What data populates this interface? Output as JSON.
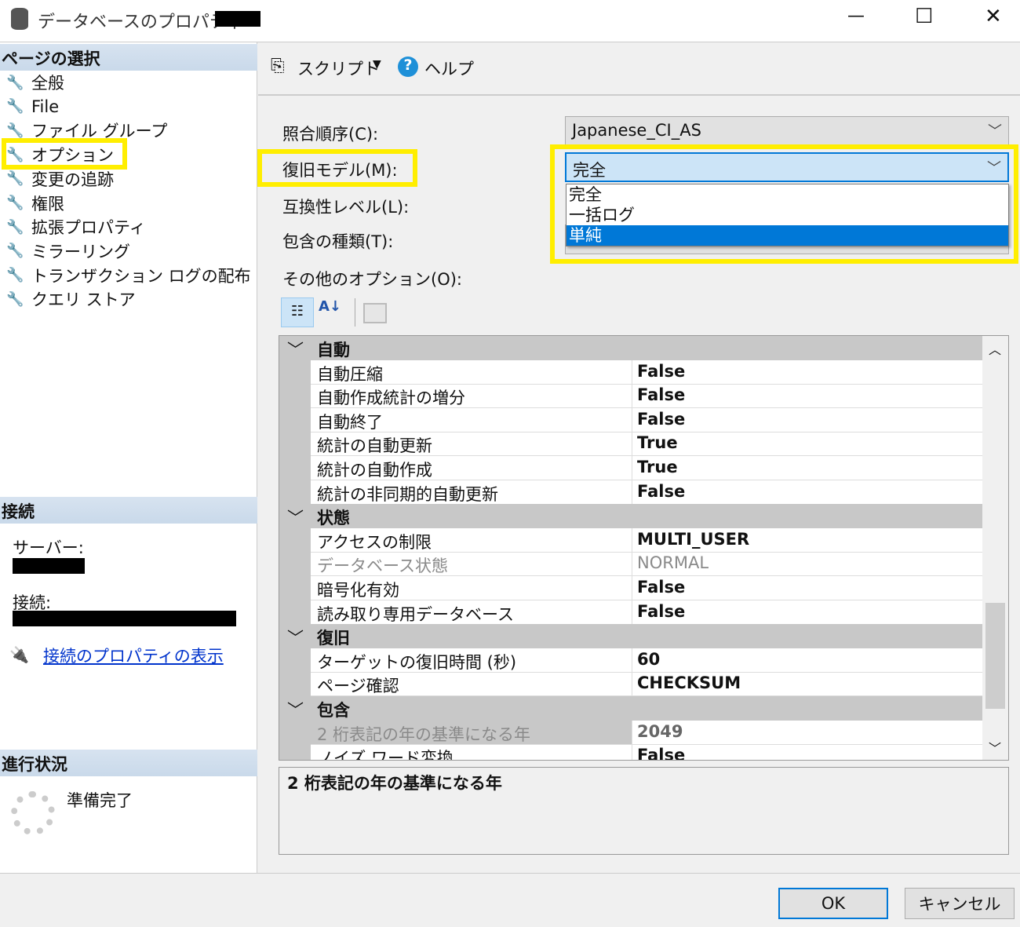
{
  "window": {
    "title": "データベースのプロパティ -",
    "minimize": "—",
    "maximize": "☐",
    "close": "✕"
  },
  "sidebar": {
    "select_page_header": "ページの選択",
    "items": [
      {
        "label": "全般"
      },
      {
        "label": "File"
      },
      {
        "label": "ファイル グループ"
      },
      {
        "label": "オプション"
      },
      {
        "label": "変更の追跡"
      },
      {
        "label": "権限"
      },
      {
        "label": "拡張プロパティ"
      },
      {
        "label": "ミラーリング"
      },
      {
        "label": "トランザクション ログの配布"
      },
      {
        "label": "クエリ ストア"
      }
    ],
    "connection_header": "接続",
    "server_label": "サーバー:",
    "connection_label": "接続:",
    "view_connection_link": "接続のプロパティの表示",
    "progress_header": "進行状況",
    "progress_status": "準備完了"
  },
  "toolbar": {
    "script": "スクリプト",
    "help": "ヘルプ"
  },
  "form": {
    "collation_label": "照合順序(C):",
    "collation_value": "Japanese_CI_AS",
    "recovery_label": "復旧モデル(M):",
    "recovery_value": "完全",
    "recovery_options": [
      "完全",
      "一括ログ",
      "単純"
    ],
    "compat_label": "互換性レベル(L):",
    "containment_label": "包含の種類(T):",
    "other_label": "その他のオプション(O):"
  },
  "grid": {
    "rows": [
      {
        "type": "cat",
        "name": "自動"
      },
      {
        "name": "自動圧縮",
        "value": "False"
      },
      {
        "name": "自動作成統計の増分",
        "value": "False"
      },
      {
        "name": "自動終了",
        "value": "False"
      },
      {
        "name": "統計の自動更新",
        "value": "True"
      },
      {
        "name": "統計の自動作成",
        "value": "True"
      },
      {
        "name": "統計の非同期的自動更新",
        "value": "False"
      },
      {
        "type": "cat",
        "name": "状態"
      },
      {
        "name": "アクセスの制限",
        "value": "MULTI_USER"
      },
      {
        "name": "データベース状態",
        "value": "NORMAL",
        "disabled": true
      },
      {
        "name": "暗号化有効",
        "value": "False"
      },
      {
        "name": "読み取り専用データベース",
        "value": "False"
      },
      {
        "type": "cat",
        "name": "復旧"
      },
      {
        "name": "ターゲットの復旧時間 (秒)",
        "value": "60"
      },
      {
        "name": "ページ確認",
        "value": "CHECKSUM"
      },
      {
        "type": "cat",
        "name": "包含"
      },
      {
        "name": "2 桁表記の年の基準になる年",
        "value": "2049",
        "selected": true
      },
      {
        "name": "ノイズ ワード変換",
        "value": "False"
      }
    ],
    "description": "2 桁表記の年の基準になる年"
  },
  "buttons": {
    "ok": "OK",
    "cancel": "キャンセル"
  },
  "colors": {
    "highlight": "#ffee00",
    "selection": "#0078d7",
    "link": "#0033cc"
  }
}
